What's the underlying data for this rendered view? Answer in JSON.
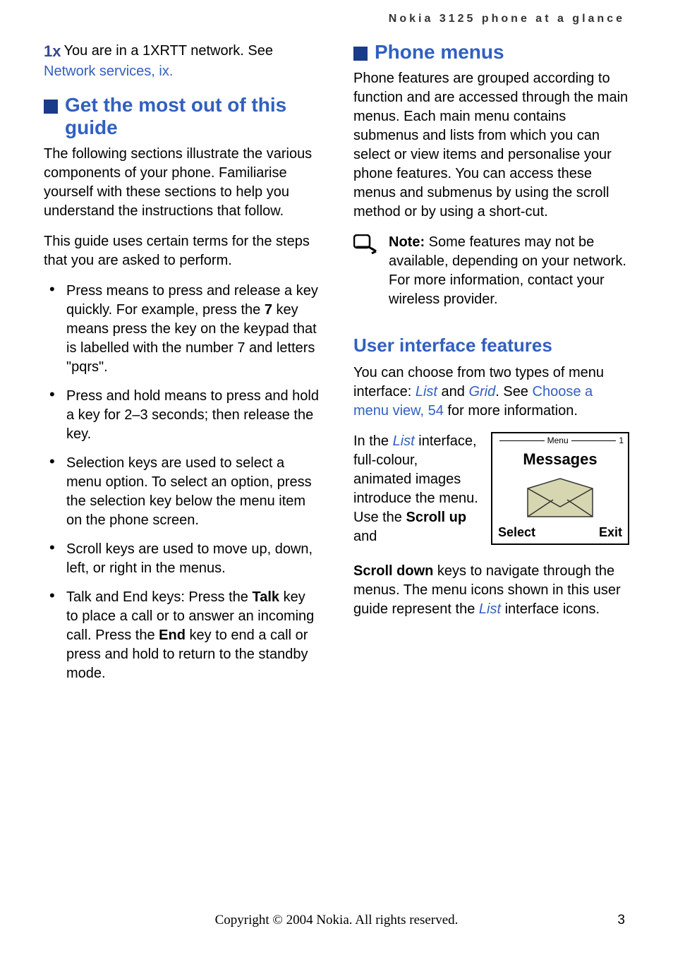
{
  "header": {
    "title": "Nokia 3125 phone at a glance"
  },
  "left": {
    "icon_label": "1x",
    "net_text_1": "You are in a 1XRTT network. See ",
    "net_link": "Network services, ix.",
    "sec1_title": "Get the most out of this guide",
    "p1": "The following sections illustrate the various components of your phone. Familiarise yourself with these sections to help you understand the instructions that follow.",
    "p2": "This guide uses certain terms for the steps that you are asked to perform.",
    "bullets": [
      {
        "pre": "Press means to press and release a key quickly. For example, press the ",
        "bold": "7",
        "post": " key means press the key on the keypad that is labelled with the number 7 and letters \"pqrs\"."
      },
      {
        "pre": "Press and hold means to press and hold a key for 2–3 seconds; then release the key.",
        "bold": "",
        "post": ""
      },
      {
        "pre": "Selection keys are used to select a menu option. To select an option, press the selection key below the menu item on the phone screen.",
        "bold": "",
        "post": ""
      },
      {
        "pre": "Scroll keys are used to move up, down, left, or right in the menus.",
        "bold": "",
        "post": ""
      },
      {
        "pre": "Talk and End keys: Press the ",
        "bold": "Talk",
        "post": " key to place a call or to answer an incoming call. Press the ",
        "bold2": "End",
        "post2": " key to end a call or press and hold to return to the standby mode."
      }
    ]
  },
  "right": {
    "sec1_title": "Phone menus",
    "p1": "Phone features are grouped according to function and are accessed through the main menus. Each main menu contains submenus and lists from which you can select or view items and personalise your phone features. You can access these menus and submenus by using the scroll method or by using a short-cut.",
    "note_bold": "Note:",
    "note_text": " Some features may not be available, depending on your network. For more information, contact your wireless provider.",
    "sec2_title": "User interface features",
    "p2_a": "You can choose from two types of menu interface: ",
    "p2_list": "List",
    "p2_b": " and ",
    "p2_grid": "Grid",
    "p2_c": ". See ",
    "p2_link": "Choose a menu view, 54",
    "p2_d": " for more information.",
    "ui_a": "In the ",
    "ui_list": "List",
    "ui_b": " interface, full-colour, animated images introduce the menu. Use the ",
    "ui_bold1": "Scroll up",
    "ui_c": " and ",
    "ui_bold2": "Scroll down",
    "ui_d": " keys to navigate through the menus. The menu icons shown in this user guide represent the ",
    "ui_list2": "List",
    "ui_e": " interface icons.",
    "fig": {
      "menu": "Menu",
      "idx": "1",
      "title": "Messages",
      "select": "Select",
      "exit": "Exit"
    }
  },
  "footer": {
    "copyright": "Copyright © 2004 Nokia. All rights reserved.",
    "page": "3"
  }
}
